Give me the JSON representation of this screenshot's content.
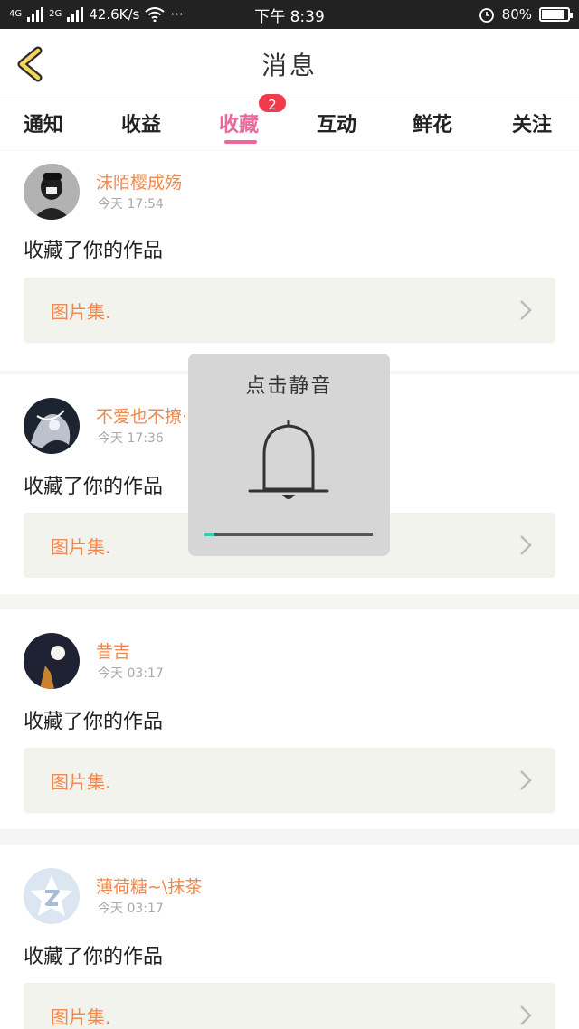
{
  "status_bar": {
    "net1": "4G",
    "net2": "2G",
    "speed": "42.6K/s",
    "more": "···",
    "time": "下午 8:39",
    "battery": "80%"
  },
  "header": {
    "title": "消息"
  },
  "tabs": [
    {
      "label": "通知"
    },
    {
      "label": "收益"
    },
    {
      "label": "收藏",
      "badge": "2"
    },
    {
      "label": "互动"
    },
    {
      "label": "鲜花"
    },
    {
      "label": "关注"
    }
  ],
  "items": [
    {
      "user": "沫陌樱成殇",
      "time": "今天 17:54",
      "action": "收藏了你的作品",
      "work": "图片集."
    },
    {
      "user": "不爱也不撩·乖",
      "time": "今天 17:36",
      "action": "收藏了你的作品",
      "work": "图片集."
    },
    {
      "user": "昔吉",
      "time": "今天 03:17",
      "action": "收藏了你的作品",
      "work": "图片集."
    },
    {
      "user": "薄荷糖~\\抹茶",
      "time": "今天 03:17",
      "action": "收藏了你的作品",
      "work": "图片集."
    }
  ],
  "mute_overlay": {
    "title": "点击静音",
    "volume_fraction": 0.06
  },
  "colors": {
    "accent": "#e96a9a",
    "username": "#f0894f",
    "badge": "#f03b4d",
    "volume": "#3cc8b4"
  }
}
